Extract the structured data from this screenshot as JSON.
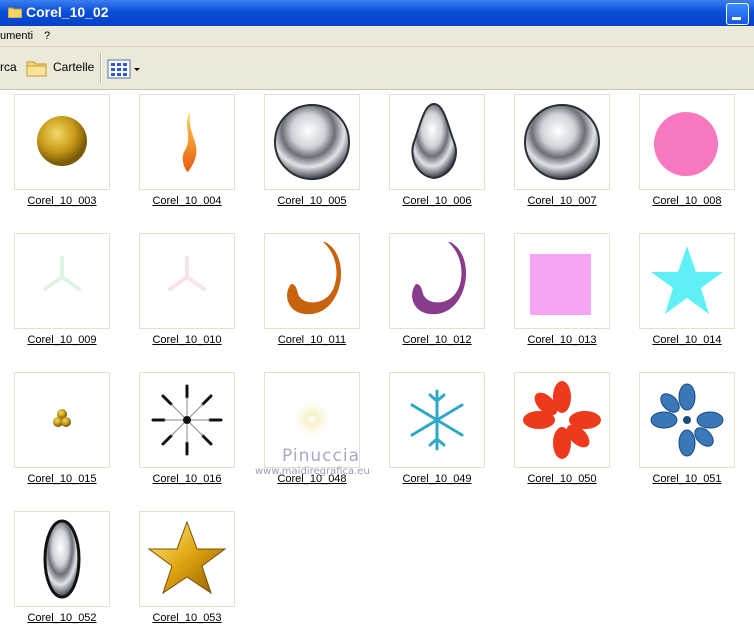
{
  "window": {
    "title": "Corel_10_02"
  },
  "menu": {
    "items": [
      "umenti",
      "?"
    ]
  },
  "toolbar": {
    "search_label": "rca",
    "folders_label": "Cartelle"
  },
  "watermark": {
    "name": "Pinuccia",
    "url": "www.maidiregrafica.eu"
  },
  "files": [
    {
      "name": "Corel_10_003",
      "icon": "gold-sphere-icon"
    },
    {
      "name": "Corel_10_004",
      "icon": "flame-icon"
    },
    {
      "name": "Corel_10_005",
      "icon": "chrome-sphere-icon"
    },
    {
      "name": "Corel_10_006",
      "icon": "chrome-drop-icon"
    },
    {
      "name": "Corel_10_007",
      "icon": "chrome-sphere-icon"
    },
    {
      "name": "Corel_10_008",
      "icon": "pink-circle-icon"
    },
    {
      "name": "Corel_10_009",
      "icon": "faint-green-star-icon"
    },
    {
      "name": "Corel_10_010",
      "icon": "faint-pink-star-icon"
    },
    {
      "name": "Corel_10_011",
      "icon": "orange-swirl-icon"
    },
    {
      "name": "Corel_10_012",
      "icon": "purple-swirl-icon"
    },
    {
      "name": "Corel_10_013",
      "icon": "pink-square-icon"
    },
    {
      "name": "Corel_10_014",
      "icon": "cyan-star-icon"
    },
    {
      "name": "Corel_10_015",
      "icon": "gold-cluster-icon"
    },
    {
      "name": "Corel_10_016",
      "icon": "black-burst-icon"
    },
    {
      "name": "Corel_10_048",
      "icon": "light-glow-icon"
    },
    {
      "name": "Corel_10_049",
      "icon": "teal-snowflake-icon"
    },
    {
      "name": "Corel_10_050",
      "icon": "red-flower-icon"
    },
    {
      "name": "Corel_10_051",
      "icon": "blue-paisley-icon"
    },
    {
      "name": "Corel_10_052",
      "icon": "chrome-ellipse-icon"
    },
    {
      "name": "Corel_10_053",
      "icon": "gold-star-icon"
    }
  ]
}
